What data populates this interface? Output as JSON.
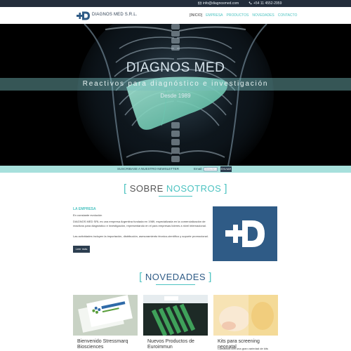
{
  "topbar": {
    "email": "info@diagnosmed.com",
    "phone": "+54 11 4552-2959"
  },
  "header": {
    "brand": "DIAGNOS MED S.R.L.",
    "nav": [
      "[INICIO]",
      "EMPRESA",
      "PRODUCTOS",
      "NOVEDADES",
      "CONTACTO"
    ]
  },
  "hero": {
    "title_part1": "DIAGNOS",
    "title_part2": " MED",
    "subtitle": "Reactivos para diagnóstico e investigación",
    "since": "Desde 1989"
  },
  "newsletter": {
    "label": "SUSCRIBASE A NUESTRO NEWSLETTER",
    "email_label": "Email:",
    "placeholder": "Dirección de email",
    "button": "ENVIAR"
  },
  "about": {
    "title_open": "[",
    "title_part1": "SOBRE ",
    "title_part2": "NOSOTROS",
    "title_close": "]",
    "heading": "LA EMPRESA",
    "subheading": "En constante evolución",
    "p1": "DIAGNOS MED SRL es una empresa Argentina fundada en 1989, especializada en la comercialización de reactivos para diagnóstico e investigación, representando en el país empresas líderes a nivel internacional.",
    "p2": "Las actividades incluyen la importación, distribución, asesoramiento técnico-científico y soporte promocional.",
    "button": "Leer más"
  },
  "news": {
    "title_open": "[",
    "title": "NOVEDADES",
    "title_close": "]",
    "cards": [
      {
        "title": "Bienvenido Stressmarq Biosciences",
        "text": ""
      },
      {
        "title": "Nuevos Productos de Euroimmun",
        "text": ""
      },
      {
        "title": "Kits para screening neonatal",
        "text": "Contamos con una gran variedad de kits"
      }
    ]
  },
  "colors": {
    "accent": "#4cc3c1",
    "dark": "#2c3e50",
    "topbar": "#232d3b",
    "logo_bg": "#2f5b86"
  }
}
